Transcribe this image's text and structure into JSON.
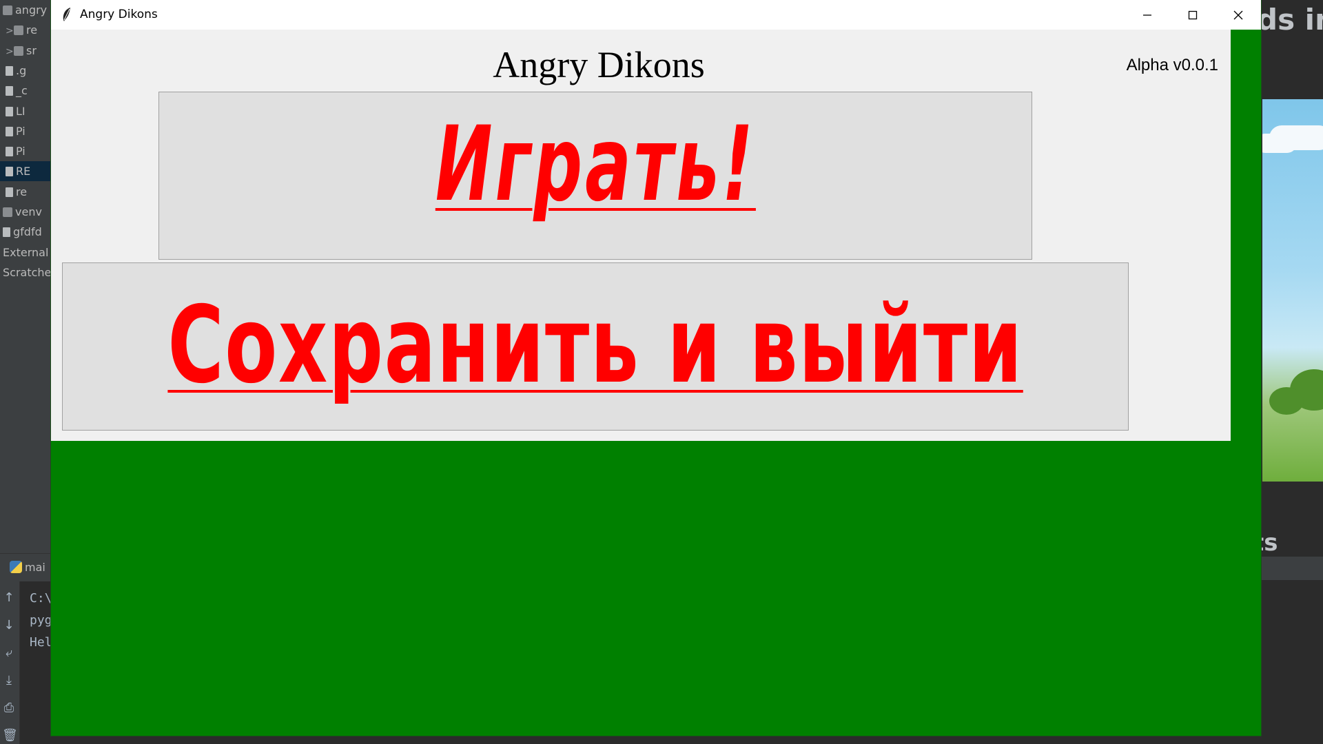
{
  "ide": {
    "project_tree": [
      {
        "label": "angry",
        "kind": "folder",
        "chevron": ""
      },
      {
        "label": "re",
        "kind": "folder",
        "chevron": ">"
      },
      {
        "label": "sr",
        "kind": "folder",
        "chevron": ">"
      },
      {
        "label": ".g",
        "kind": "file",
        "chevron": ""
      },
      {
        "label": "_c",
        "kind": "file",
        "chevron": ""
      },
      {
        "label": "LI",
        "kind": "file",
        "chevron": ""
      },
      {
        "label": "Pi",
        "kind": "file",
        "chevron": ""
      },
      {
        "label": "Pi",
        "kind": "file",
        "chevron": ""
      },
      {
        "label": "RE",
        "kind": "file",
        "chevron": ""
      },
      {
        "label": "re",
        "kind": "file",
        "chevron": ""
      },
      {
        "label": "venv",
        "kind": "folder",
        "chevron": ""
      },
      {
        "label": "gfdfd",
        "kind": "file",
        "chevron": ""
      },
      {
        "label": "External",
        "kind": "none",
        "chevron": ""
      },
      {
        "label": "Scratches",
        "kind": "none",
        "chevron": ""
      }
    ],
    "run_tab": "mai",
    "console_lines": [
      "C:\\",
      "pyg",
      "Hel"
    ]
  },
  "background_page": {
    "heading": "ds in",
    "subheading": "ts"
  },
  "window": {
    "title": "Angry Dikons",
    "controls": {
      "minimize": "—",
      "maximize": "☐",
      "close": "✕"
    }
  },
  "menu": {
    "game_title": "Angry Dikons",
    "version": "Alpha v0.0.1",
    "play_button_label": "Играть!",
    "save_exit_button_label": "Сохранить и выйти"
  },
  "colors": {
    "window_background": "#008000",
    "frame_background": "#f0f0f0",
    "button_text": "#ff0000",
    "button_background": "#e0e0e0"
  }
}
